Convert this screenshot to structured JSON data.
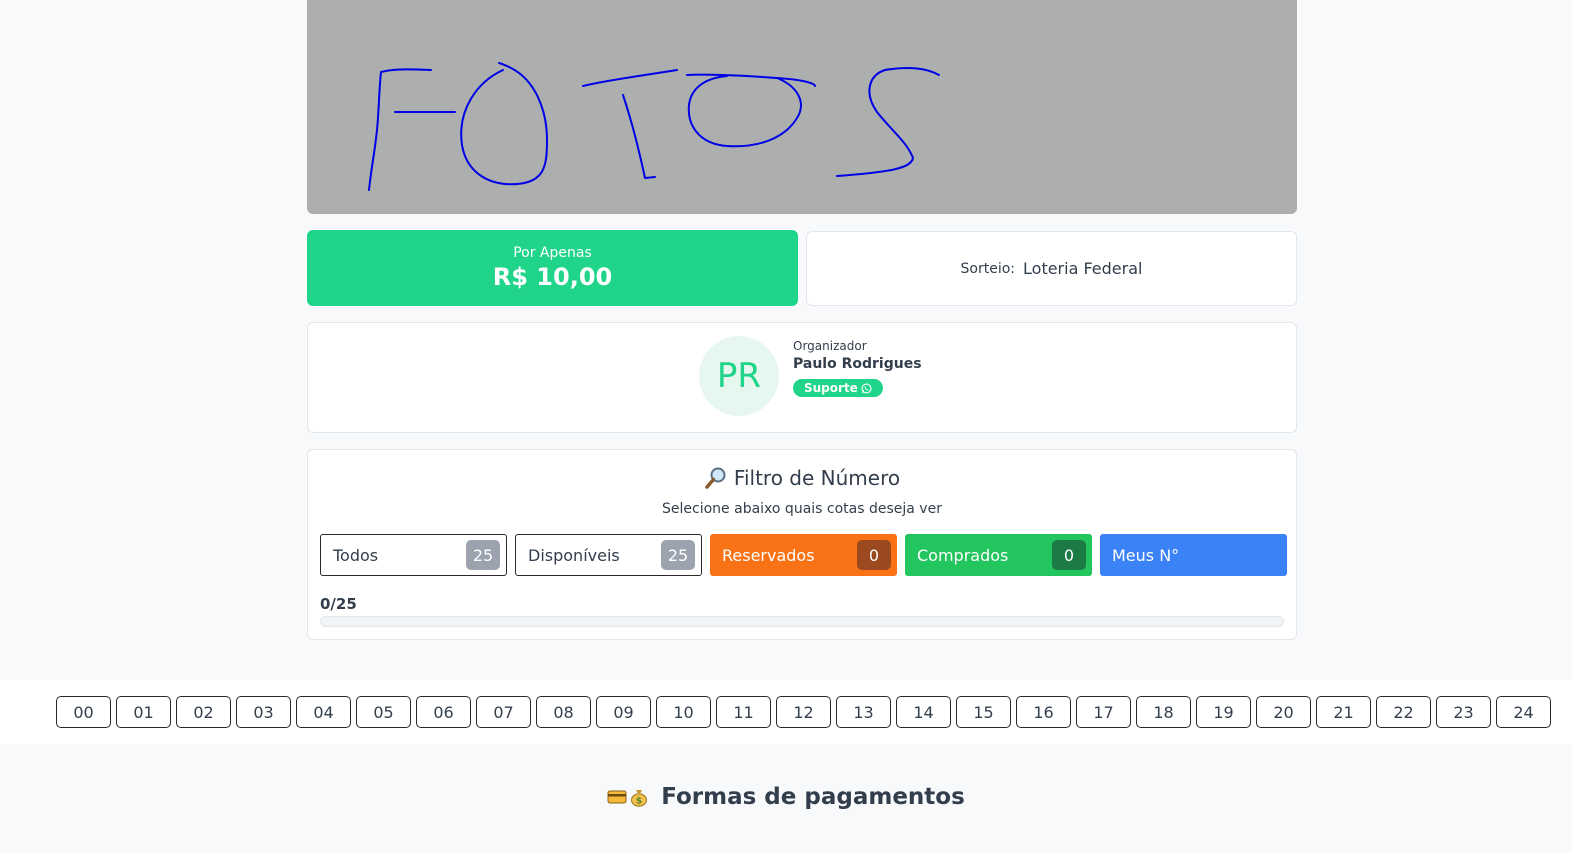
{
  "banner": {
    "handwritten_text": "FOTOS",
    "background_color": "#adafae",
    "ink_color": "#0000e6"
  },
  "price": {
    "label": "Por Apenas",
    "value": "R$ 10,00"
  },
  "draw": {
    "label": "Sorteio:",
    "value": "Loteria Federal"
  },
  "organizer": {
    "initials": "PR",
    "role_label": "Organizador",
    "name": "Paulo Rodrigues",
    "support_label": "Suporte",
    "support_icon": "whatsapp-icon"
  },
  "filter": {
    "icon": "magnifier-icon",
    "title": "Filtro de Número",
    "subtitle": "Selecione abaixo quais cotas deseja ver",
    "buttons": [
      {
        "label": "Todos",
        "count": "25"
      },
      {
        "label": "Disponíveis",
        "count": "25"
      },
      {
        "label": "Reservados",
        "count": "0"
      },
      {
        "label": "Comprados",
        "count": "0"
      },
      {
        "label": "Meus N°"
      }
    ],
    "progress_label": "0/25",
    "progress_fraction": 0
  },
  "numbers": [
    "00",
    "01",
    "02",
    "03",
    "04",
    "05",
    "06",
    "07",
    "08",
    "09",
    "10",
    "11",
    "12",
    "13",
    "14",
    "15",
    "16",
    "17",
    "18",
    "19",
    "20",
    "21",
    "22",
    "23",
    "24"
  ],
  "payments": {
    "icons": [
      "credit-card-icon",
      "money-bag-icon"
    ],
    "title": "Formas de pagamentos"
  },
  "colors": {
    "accent": "#20d489",
    "reserved": "#f97316",
    "purchased": "#22c55e",
    "mine": "#3b82f6"
  }
}
